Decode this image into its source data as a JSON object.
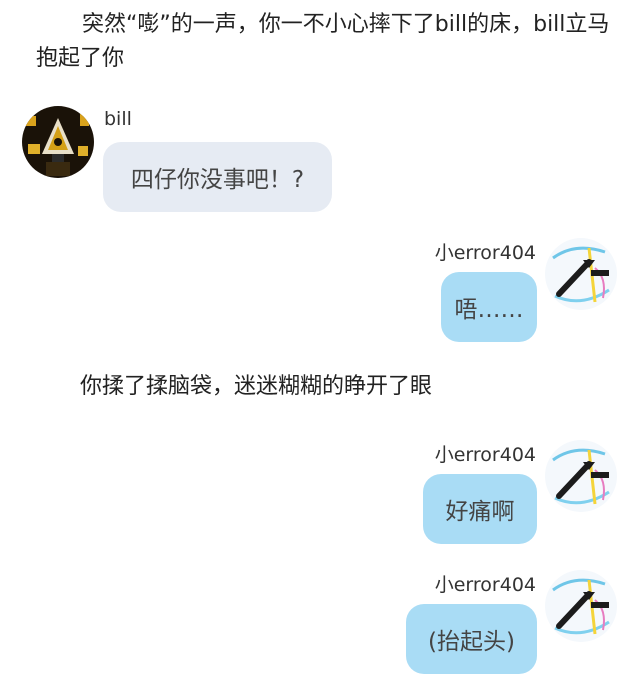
{
  "narrations": [
    "突然“嘭”的一声，你一不小心摔下了bill的床，bill立马抱起了你",
    "你揉了揉脑袋，迷迷糊糊的睁开了眼"
  ],
  "messages": [
    {
      "sender": "bill",
      "side": "left",
      "text": "四仔你没事吧！?"
    },
    {
      "sender": "小error404",
      "side": "right",
      "text": "唔……"
    },
    {
      "sender": "小error404",
      "side": "right",
      "text": "好痛啊"
    },
    {
      "sender": "小error404",
      "side": "right",
      "text": "(抬起头)"
    }
  ],
  "colors": {
    "left_bubble": "#e6ebf3",
    "right_bubble": "#a9dcf5"
  }
}
